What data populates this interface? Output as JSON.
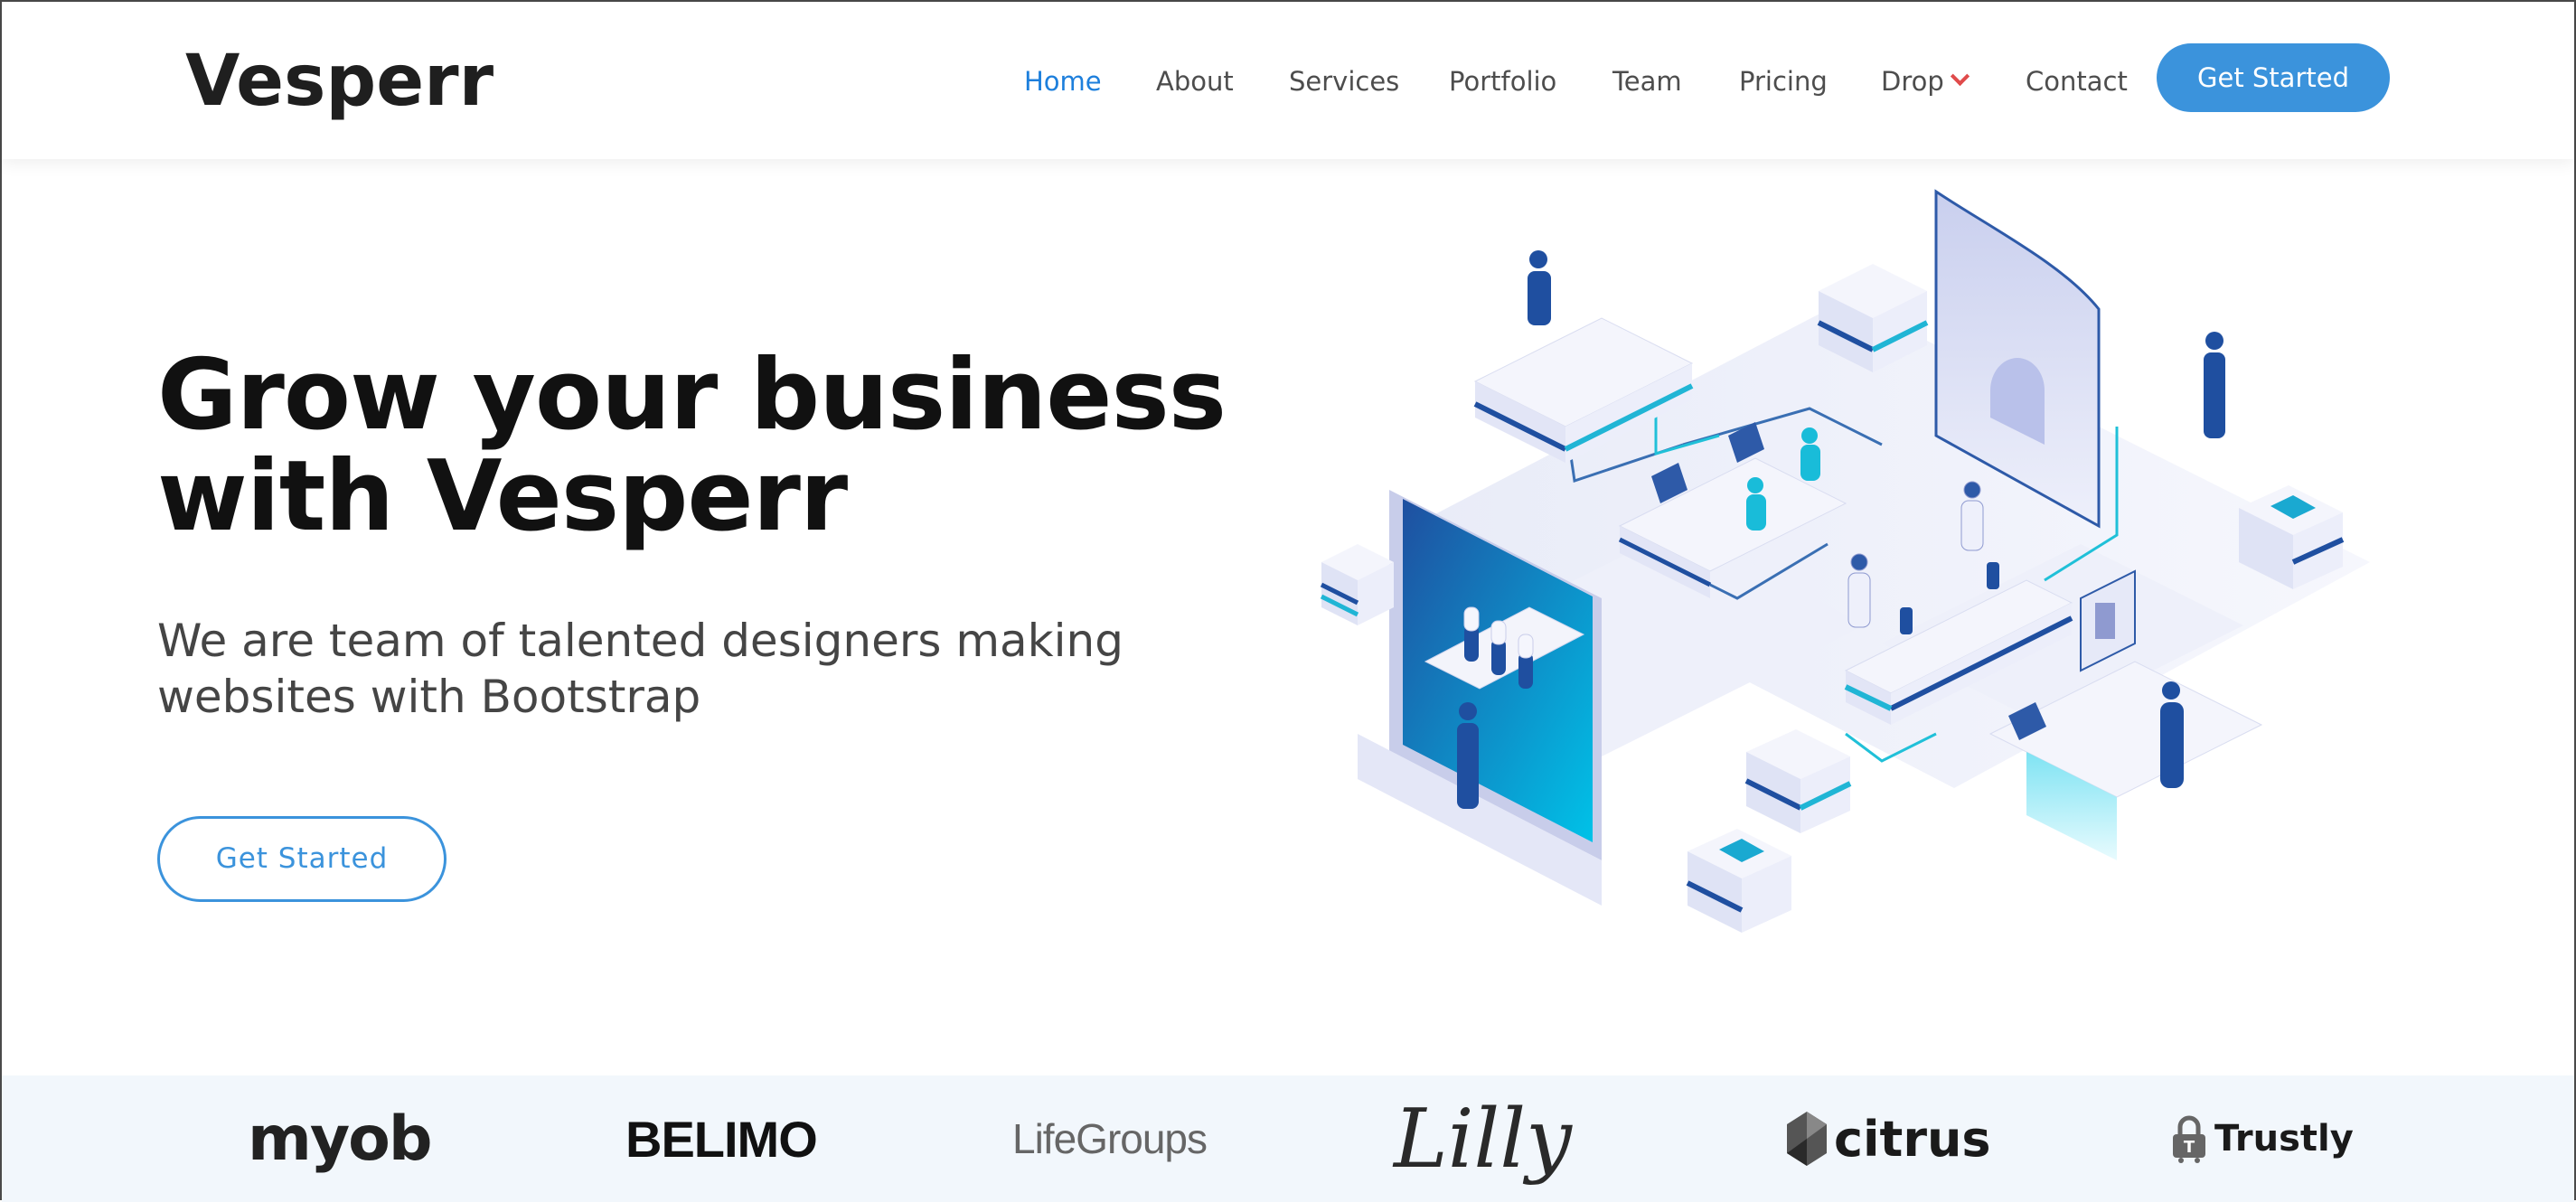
{
  "header": {
    "logo": "Vesperr",
    "nav": [
      {
        "label": "Home",
        "active": true
      },
      {
        "label": "About"
      },
      {
        "label": "Services"
      },
      {
        "label": "Portfolio"
      },
      {
        "label": "Team"
      },
      {
        "label": "Pricing"
      },
      {
        "label": "Drop",
        "has_dropdown": true
      },
      {
        "label": "Contact"
      }
    ],
    "cta_label": "Get Started"
  },
  "hero": {
    "title_line1": "Grow your business",
    "title_line2": "with Vesperr",
    "subtitle_line1": "We are team of talented designers making",
    "subtitle_line2": "websites with Bootstrap",
    "cta_label": "Get Started"
  },
  "clients": {
    "logos": [
      "myob",
      "BELIMO",
      "LifeGroups",
      "Lilly",
      "citrus",
      "Trustly"
    ]
  },
  "colors": {
    "accent": "#3b93dc",
    "nav_active": "#1d7fdc",
    "dropdown_chevron": "#e04b4b",
    "clients_bg": "#f2f7fc"
  }
}
